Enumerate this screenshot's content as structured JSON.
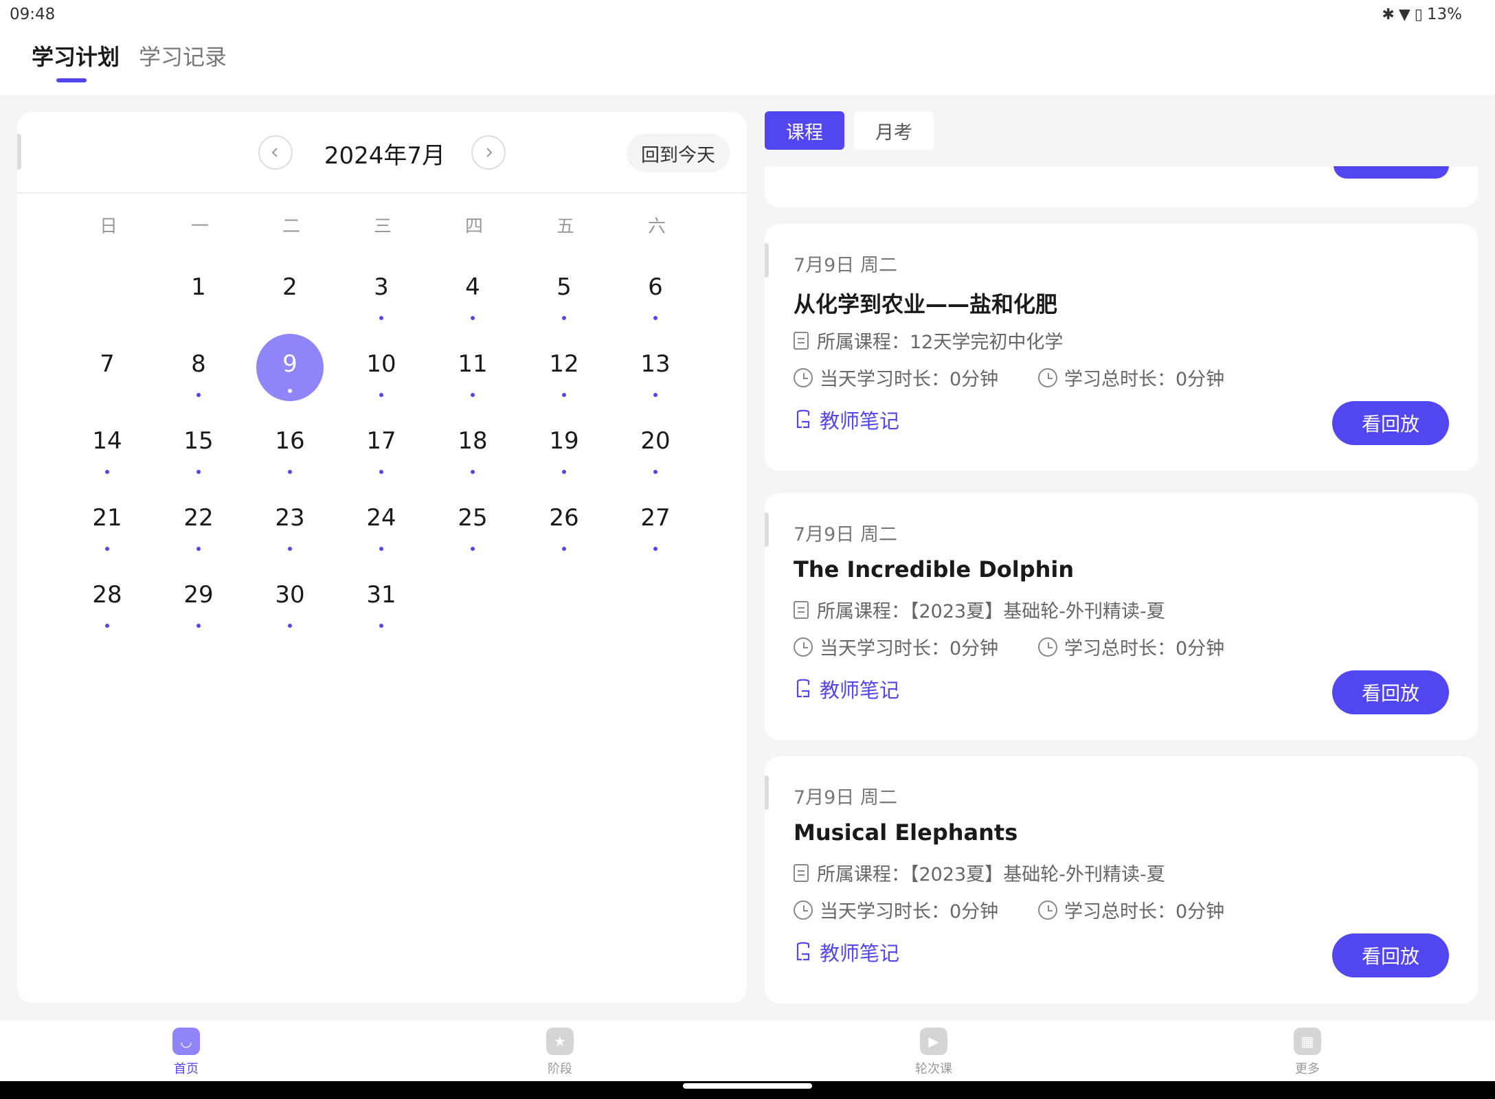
{
  "status": {
    "time": "09:48",
    "battery": "13%"
  },
  "tabs": {
    "active": "学习计划",
    "inactive": "学习记录"
  },
  "calendar": {
    "title": "2024年7月",
    "today_label": "回到今天",
    "prev_icon": "chevron-left-icon",
    "next_icon": "chevron-right-icon",
    "weekdays": [
      "日",
      "一",
      "二",
      "三",
      "四",
      "五",
      "六"
    ],
    "selected_day": "9",
    "days": [
      "1",
      "2",
      "3",
      "4",
      "5",
      "6",
      "7",
      "8",
      "9",
      "10",
      "11",
      "12",
      "13",
      "14",
      "15",
      "16",
      "17",
      "18",
      "19",
      "20",
      "21",
      "22",
      "23",
      "24",
      "25",
      "26",
      "27",
      "28",
      "29",
      "30",
      "31"
    ]
  },
  "segments": {
    "course": "课程",
    "exam": "月考"
  },
  "labels": {
    "belong_prefix": "所属课程：",
    "day_duration": "当天学习时长：0分钟",
    "total_duration": "学习总时长：0分钟",
    "teacher_notes": "教师笔记",
    "replay": "看回放"
  },
  "courses": [
    {
      "date": "7月9日 周二",
      "title": "从化学到农业——盐和化肥",
      "belong": "12天学完初中化学"
    },
    {
      "date": "7月9日 周二",
      "title": "The Incredible Dolphin",
      "belong": "【2023夏】基础轮-外刊精读-夏"
    },
    {
      "date": "7月9日 周二",
      "title": "Musical Elephants",
      "belong": "【2023夏】基础轮-外刊精读-夏"
    }
  ],
  "bottom_nav": [
    {
      "label": "首页",
      "icon": "home-icon",
      "active": true
    },
    {
      "label": "阶段",
      "icon": "stage-icon",
      "active": false
    },
    {
      "label": "轮次课",
      "icon": "video-icon",
      "active": false
    },
    {
      "label": "更多",
      "icon": "more-grid-icon",
      "active": false
    }
  ],
  "colors": {
    "accent": "#5146ef",
    "selected_day": "#8f84f8"
  }
}
